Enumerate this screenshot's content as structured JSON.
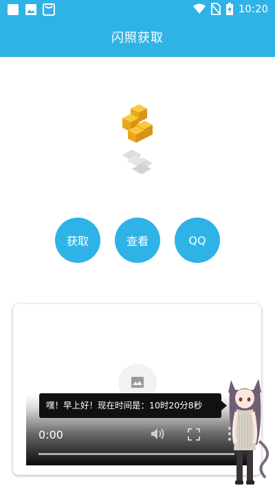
{
  "status_bar": {
    "time": "10:20",
    "left_icons": [
      "square-icon",
      "image-icon",
      "store-icon"
    ],
    "right_icons": [
      "wifi-icon",
      "no-sim-icon",
      "battery-charging-icon"
    ]
  },
  "app_bar": {
    "title": "闪照获取"
  },
  "actions": {
    "get_label": "获取",
    "view_label": "查看",
    "qq_label": "QQ"
  },
  "player": {
    "current_time": "0:00",
    "progress": 0,
    "icons": [
      "image-placeholder-icon",
      "volume-icon",
      "fullscreen-icon",
      "more-vert-icon"
    ]
  },
  "toast": {
    "message": "嘿！早上好！现在时间是：10时20分8秒"
  },
  "colors": {
    "primary": "#2fb3e6",
    "logo_gold": "#f3b21f",
    "logo_shadow": "#d9d9d9"
  }
}
